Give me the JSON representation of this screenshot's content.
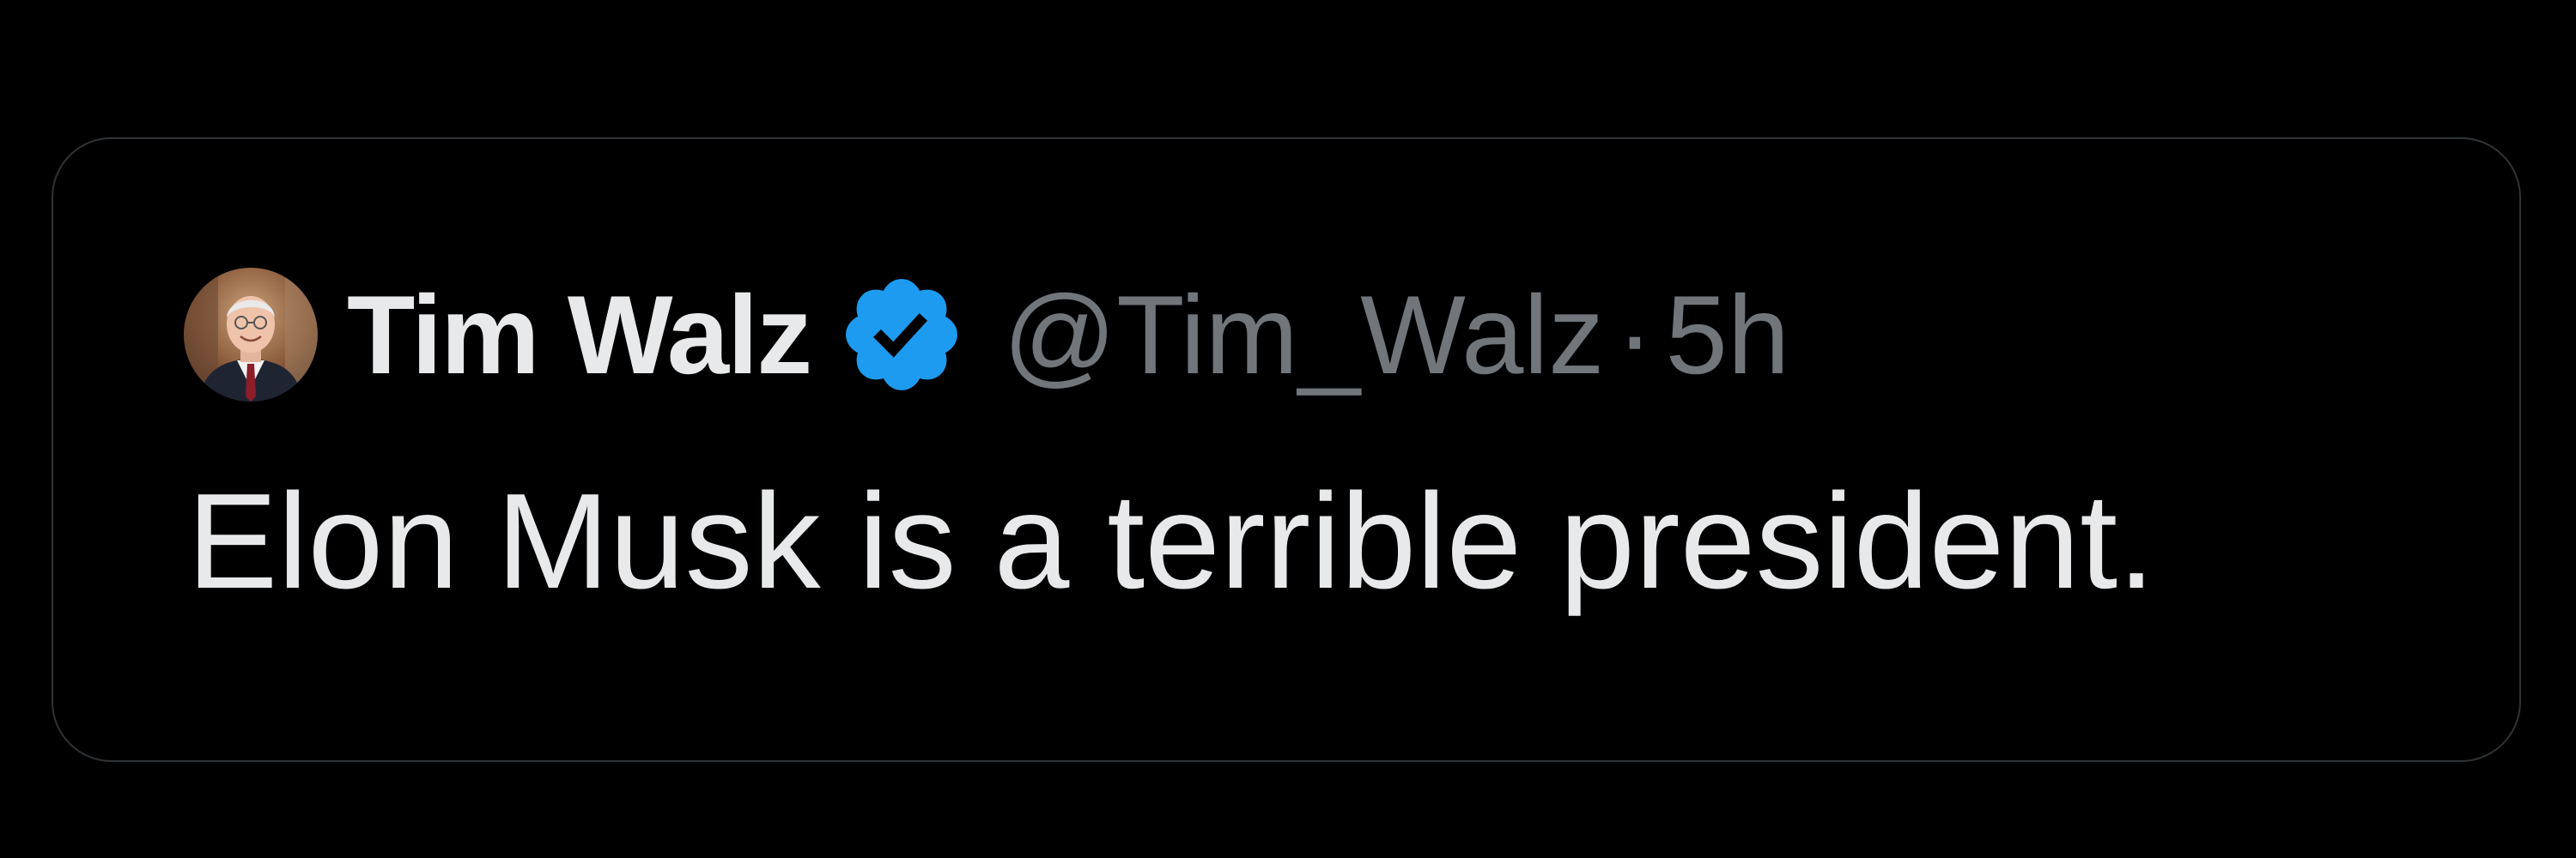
{
  "tweet": {
    "author": {
      "name": "Tim Walz",
      "handle": "@Tim_Walz",
      "verified": true,
      "avatar_icon": "profile-photo"
    },
    "separator": "·",
    "timestamp": "5h",
    "text": "Elon Musk is a terrible president."
  },
  "colors": {
    "background": "#000000",
    "border": "#2f3336",
    "primary_text": "#e7e9ea",
    "secondary_text": "#71767b",
    "verified_badge": "#1d9bf0"
  }
}
